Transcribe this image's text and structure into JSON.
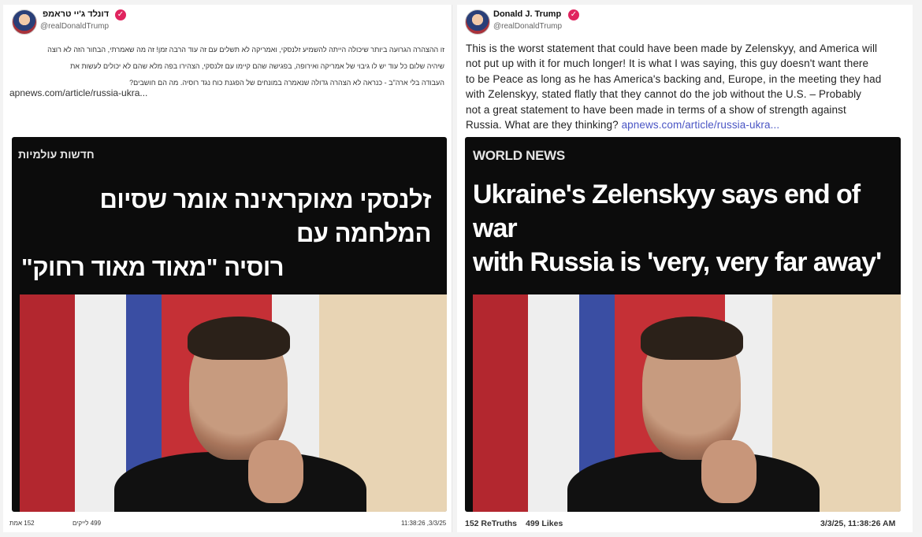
{
  "left": {
    "author_name": "דונלד ג'יי טראמפ",
    "handle": "@realDonaldTrump",
    "lines": [
      "זו ההצהרה הגרועה ביותר שיכולה הייתה להשמיע זלנסקי, ואמריקה לא תשלים עם זה עוד הרבה זמן! זה מה שאמרתי, הבחור הזה לא רוצה",
      "שיהיה שלום כל עוד יש לו גיבוי של אמריקה ואירופה, בפגישה שהם קיימו עם זלנסקי, הצהירו בפה מלא שהם לא יכולים לעשות את",
      "העבודה בלי ארה\"ב - כנראה לא הצהרה גדולה שנאמרה במונחים של הפגנת כוח נגד רוסיה. מה הם חושבים?"
    ],
    "link": "apnews.com/article/russia-ukra...",
    "card_kicker": "חדשות עולמיות",
    "headline_line1": "זלנסקי מאוקראינה אומר שסיום המלחמה עם",
    "headline_line2": "רוסיה \"מאוד מאוד רחוק\"",
    "footer_retruths": "152 אמת",
    "footer_likes": "499 לייקים",
    "footer_time": "11:38:26 ,3/3/25"
  },
  "right": {
    "author_name": "Donald J. Trump",
    "handle": "@realDonaldTrump",
    "lines": [
      "This is the worst statement that could have been made by Zelenskyy, and America will",
      "not put up with it for much longer! It is what I was saying, this guy doesn't want there",
      "to be Peace as long as he has America's backing and, Europe, in the meeting they had",
      "with Zelenskyy, stated flatly that they cannot do the job without the U.S. – Probably",
      "not a great statement to have been made in terms of a show of strength against"
    ],
    "last_line": "Russia. What are they thinking?",
    "link": "apnews.com/article/russia-ukra...",
    "card_kicker": "WORLD NEWS",
    "headline_line1": "Ukraine's Zelenskyy says end of war",
    "headline_line2": "with Russia is 'very, very far away'",
    "footer_retruths": "152 ReTruths",
    "footer_likes": "499 Likes",
    "footer_time": "3/3/25, 11:38:26 AM"
  },
  "icons": {
    "verified": "verified-badge-icon",
    "avatar": "profile-avatar"
  },
  "colors": {
    "link": "#4a55c4",
    "verified": "#e0245e",
    "card_bg": "#0c0c0c"
  }
}
